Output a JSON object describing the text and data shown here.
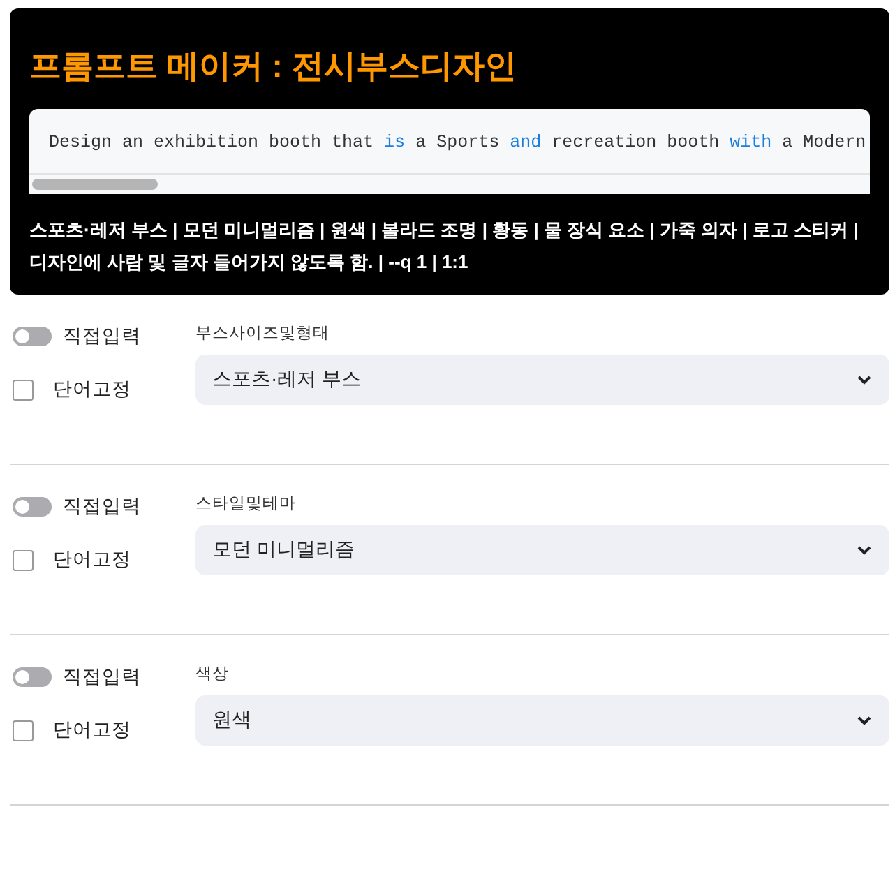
{
  "header": {
    "title": "프롬프트 메이커 : 전시부스디자인",
    "code": [
      {
        "text": "Design an exhibition booth that ",
        "kind": "plain"
      },
      {
        "text": "is",
        "kind": "keyword"
      },
      {
        "text": " a Sports ",
        "kind": "plain"
      },
      {
        "text": "and",
        "kind": "keyword"
      },
      {
        "text": " recreation booth ",
        "kind": "plain"
      },
      {
        "text": "with",
        "kind": "keyword"
      },
      {
        "text": " a Modern",
        "kind": "plain"
      }
    ],
    "summary": "스포츠·레저 부스 | 모던 미니멀리즘 | 원색 | 볼라드 조명 | 황동 | 물 장식 요소 | 가죽 의자 | 로고 스티커 | 디자인에 사람 및 글자 들어가지 않도록 함. | --q 1 | 1:1"
  },
  "fields": [
    {
      "toggle_label": "직접입력",
      "toggle_on": false,
      "checkbox_label": "단어고정",
      "checked": false,
      "label": "부스사이즈및형태",
      "value": "스포츠·레저 부스"
    },
    {
      "toggle_label": "직접입력",
      "toggle_on": false,
      "checkbox_label": "단어고정",
      "checked": false,
      "label": "스타일및테마",
      "value": "모던 미니멀리즘"
    },
    {
      "toggle_label": "직접입력",
      "toggle_on": false,
      "checkbox_label": "단어고정",
      "checked": false,
      "label": "색상",
      "value": "원색"
    }
  ]
}
